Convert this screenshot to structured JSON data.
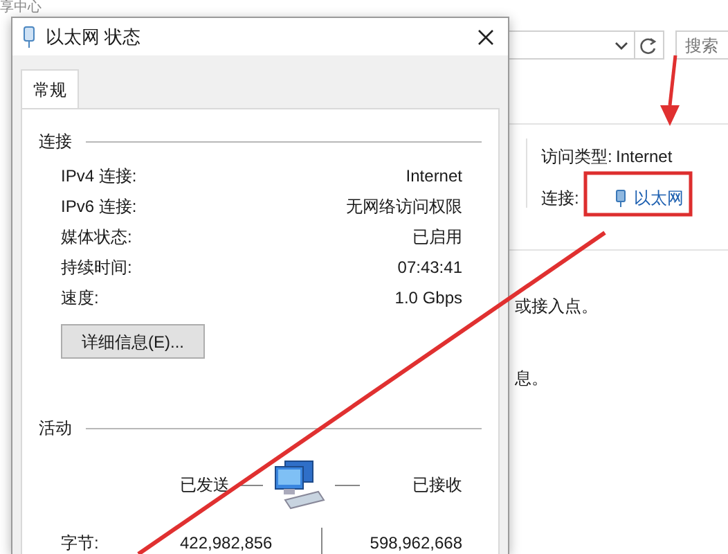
{
  "background_window": {
    "title": "享中心",
    "search": {
      "placeholder": "搜索"
    },
    "details": [
      {
        "label": "访问类型:",
        "value": "Internet",
        "kind": "text"
      },
      {
        "label": "连接:",
        "value": "以太网",
        "kind": "link"
      }
    ],
    "messages": [
      "或接入点。",
      "息。"
    ]
  },
  "dialog": {
    "title": "以太网 状态",
    "tabs": [
      {
        "label": "常规",
        "selected": true
      }
    ],
    "connection": {
      "heading": "连接",
      "rows": [
        {
          "label": "IPv4 连接:",
          "value": "Internet"
        },
        {
          "label": "IPv6 连接:",
          "value": "无网络访问权限"
        },
        {
          "label": "媒体状态:",
          "value": "已启用"
        },
        {
          "label": "持续时间:",
          "value": "07:43:41"
        },
        {
          "label": "速度:",
          "value": "1.0 Gbps"
        }
      ],
      "button": "详细信息(E)..."
    },
    "activity": {
      "heading": "活动",
      "sent_label": "已发送",
      "received_label": "已接收",
      "bytes": {
        "label": "字节:",
        "sent": "422,982,856",
        "received": "598,962,668"
      }
    }
  }
}
